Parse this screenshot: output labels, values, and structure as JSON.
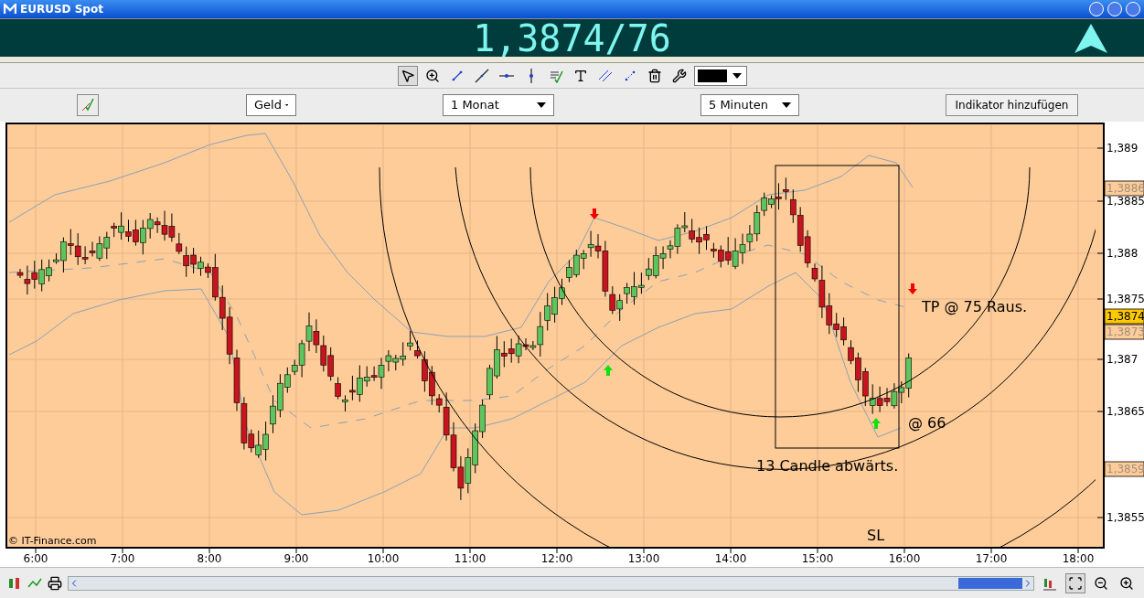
{
  "window": {
    "title": "EURUSD Spot"
  },
  "quote": {
    "price": "1,3874/76"
  },
  "tools": [
    {
      "selected": true
    },
    {
      "selected": false
    },
    {
      "selected": false
    },
    {
      "selected": false
    },
    {
      "selected": false
    },
    {
      "selected": false
    },
    {
      "selected": false
    },
    {
      "selected": false
    },
    {
      "selected": false
    },
    {
      "selected": false
    },
    {
      "selected": false
    },
    {
      "selected": false
    }
  ],
  "controls": {
    "price_type": "Geld",
    "range": "1 Monat",
    "interval": "5 Minuten",
    "add_indicator": "Indikator hinzufügen"
  },
  "chart": {
    "y_labels": [
      "1,389",
      "1,3885",
      "1,388",
      "1,3875",
      "1,387",
      "1,3865",
      "1,3855"
    ],
    "price_tags": [
      {
        "text": "1,3886",
        "kind": "level"
      },
      {
        "text": "1,3874",
        "kind": "current"
      },
      {
        "text": "1,3873",
        "kind": "level"
      },
      {
        "text": "1,3859",
        "kind": "level"
      }
    ],
    "x_labels": [
      "6:00",
      "7:00",
      "8:00",
      "9:00",
      "10:00",
      "11:00",
      "12:00",
      "13:00",
      "14:00",
      "15:00",
      "16:00",
      "17:00",
      "18:00"
    ],
    "signals": [
      {
        "kind": "sell"
      },
      {
        "kind": "buy"
      },
      {
        "kind": "buy"
      },
      {
        "kind": "sell"
      }
    ],
    "annotations": [
      "TP @ 75 Raus.",
      "@ 66",
      "13 Candle abwärts.",
      "SL"
    ],
    "copyright": "© IT-Finance.com"
  },
  "bottom_tools": [
    {
      "selected": false
    },
    {
      "selected": true
    },
    {
      "selected": false
    },
    {
      "selected": false
    }
  ]
}
